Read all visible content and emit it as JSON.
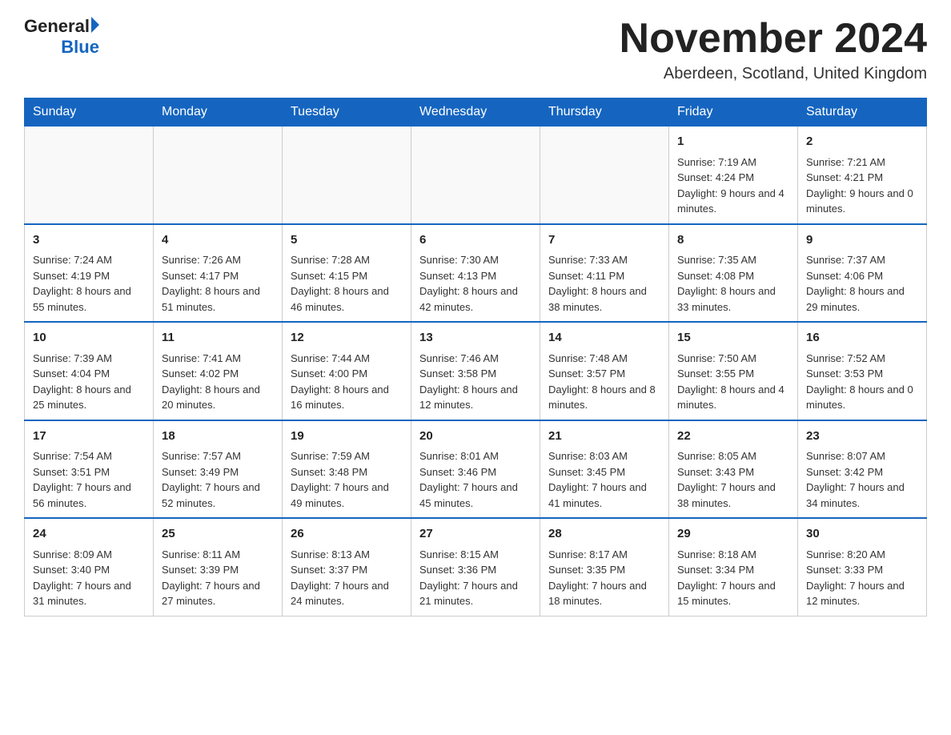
{
  "header": {
    "logo_general": "General",
    "logo_blue": "Blue",
    "title": "November 2024",
    "location": "Aberdeen, Scotland, United Kingdom"
  },
  "weekdays": [
    "Sunday",
    "Monday",
    "Tuesday",
    "Wednesday",
    "Thursday",
    "Friday",
    "Saturday"
  ],
  "weeks": [
    [
      {
        "day": "",
        "info": ""
      },
      {
        "day": "",
        "info": ""
      },
      {
        "day": "",
        "info": ""
      },
      {
        "day": "",
        "info": ""
      },
      {
        "day": "",
        "info": ""
      },
      {
        "day": "1",
        "info": "Sunrise: 7:19 AM\nSunset: 4:24 PM\nDaylight: 9 hours and 4 minutes."
      },
      {
        "day": "2",
        "info": "Sunrise: 7:21 AM\nSunset: 4:21 PM\nDaylight: 9 hours and 0 minutes."
      }
    ],
    [
      {
        "day": "3",
        "info": "Sunrise: 7:24 AM\nSunset: 4:19 PM\nDaylight: 8 hours and 55 minutes."
      },
      {
        "day": "4",
        "info": "Sunrise: 7:26 AM\nSunset: 4:17 PM\nDaylight: 8 hours and 51 minutes."
      },
      {
        "day": "5",
        "info": "Sunrise: 7:28 AM\nSunset: 4:15 PM\nDaylight: 8 hours and 46 minutes."
      },
      {
        "day": "6",
        "info": "Sunrise: 7:30 AM\nSunset: 4:13 PM\nDaylight: 8 hours and 42 minutes."
      },
      {
        "day": "7",
        "info": "Sunrise: 7:33 AM\nSunset: 4:11 PM\nDaylight: 8 hours and 38 minutes."
      },
      {
        "day": "8",
        "info": "Sunrise: 7:35 AM\nSunset: 4:08 PM\nDaylight: 8 hours and 33 minutes."
      },
      {
        "day": "9",
        "info": "Sunrise: 7:37 AM\nSunset: 4:06 PM\nDaylight: 8 hours and 29 minutes."
      }
    ],
    [
      {
        "day": "10",
        "info": "Sunrise: 7:39 AM\nSunset: 4:04 PM\nDaylight: 8 hours and 25 minutes."
      },
      {
        "day": "11",
        "info": "Sunrise: 7:41 AM\nSunset: 4:02 PM\nDaylight: 8 hours and 20 minutes."
      },
      {
        "day": "12",
        "info": "Sunrise: 7:44 AM\nSunset: 4:00 PM\nDaylight: 8 hours and 16 minutes."
      },
      {
        "day": "13",
        "info": "Sunrise: 7:46 AM\nSunset: 3:58 PM\nDaylight: 8 hours and 12 minutes."
      },
      {
        "day": "14",
        "info": "Sunrise: 7:48 AM\nSunset: 3:57 PM\nDaylight: 8 hours and 8 minutes."
      },
      {
        "day": "15",
        "info": "Sunrise: 7:50 AM\nSunset: 3:55 PM\nDaylight: 8 hours and 4 minutes."
      },
      {
        "day": "16",
        "info": "Sunrise: 7:52 AM\nSunset: 3:53 PM\nDaylight: 8 hours and 0 minutes."
      }
    ],
    [
      {
        "day": "17",
        "info": "Sunrise: 7:54 AM\nSunset: 3:51 PM\nDaylight: 7 hours and 56 minutes."
      },
      {
        "day": "18",
        "info": "Sunrise: 7:57 AM\nSunset: 3:49 PM\nDaylight: 7 hours and 52 minutes."
      },
      {
        "day": "19",
        "info": "Sunrise: 7:59 AM\nSunset: 3:48 PM\nDaylight: 7 hours and 49 minutes."
      },
      {
        "day": "20",
        "info": "Sunrise: 8:01 AM\nSunset: 3:46 PM\nDaylight: 7 hours and 45 minutes."
      },
      {
        "day": "21",
        "info": "Sunrise: 8:03 AM\nSunset: 3:45 PM\nDaylight: 7 hours and 41 minutes."
      },
      {
        "day": "22",
        "info": "Sunrise: 8:05 AM\nSunset: 3:43 PM\nDaylight: 7 hours and 38 minutes."
      },
      {
        "day": "23",
        "info": "Sunrise: 8:07 AM\nSunset: 3:42 PM\nDaylight: 7 hours and 34 minutes."
      }
    ],
    [
      {
        "day": "24",
        "info": "Sunrise: 8:09 AM\nSunset: 3:40 PM\nDaylight: 7 hours and 31 minutes."
      },
      {
        "day": "25",
        "info": "Sunrise: 8:11 AM\nSunset: 3:39 PM\nDaylight: 7 hours and 27 minutes."
      },
      {
        "day": "26",
        "info": "Sunrise: 8:13 AM\nSunset: 3:37 PM\nDaylight: 7 hours and 24 minutes."
      },
      {
        "day": "27",
        "info": "Sunrise: 8:15 AM\nSunset: 3:36 PM\nDaylight: 7 hours and 21 minutes."
      },
      {
        "day": "28",
        "info": "Sunrise: 8:17 AM\nSunset: 3:35 PM\nDaylight: 7 hours and 18 minutes."
      },
      {
        "day": "29",
        "info": "Sunrise: 8:18 AM\nSunset: 3:34 PM\nDaylight: 7 hours and 15 minutes."
      },
      {
        "day": "30",
        "info": "Sunrise: 8:20 AM\nSunset: 3:33 PM\nDaylight: 7 hours and 12 minutes."
      }
    ]
  ]
}
